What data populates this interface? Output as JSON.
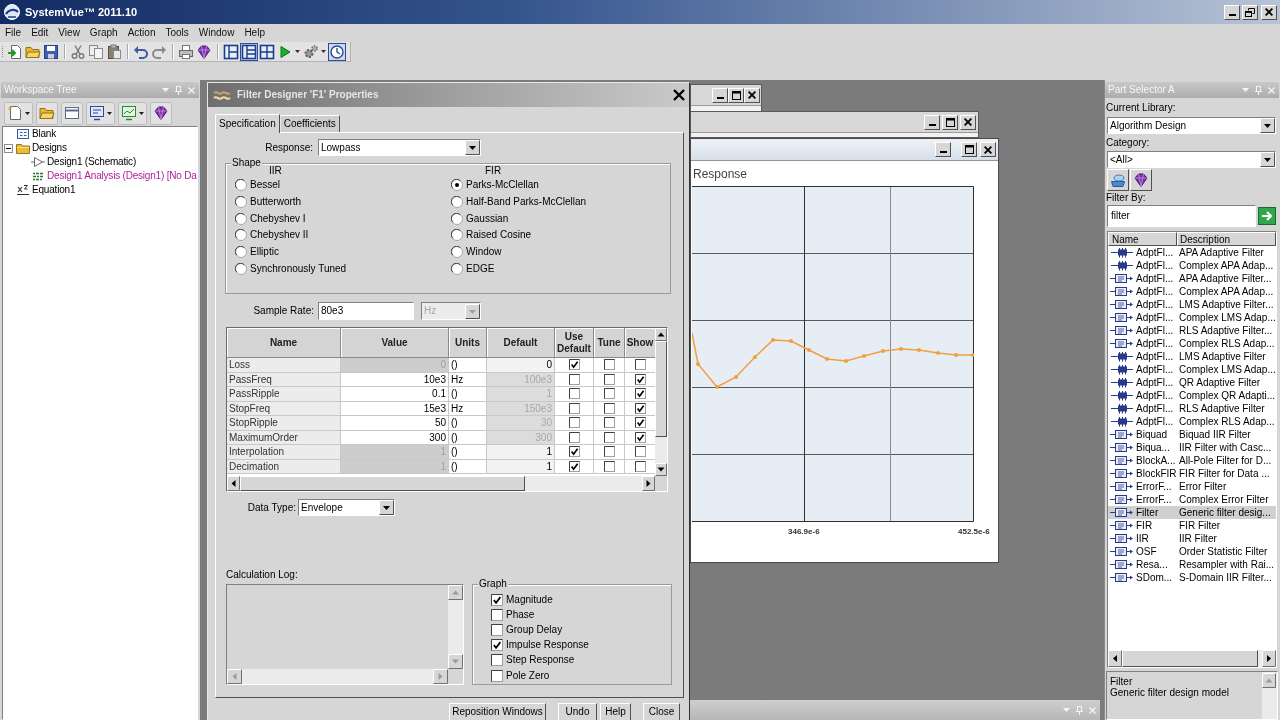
{
  "app": {
    "title": "SystemVue™ 2011.10"
  },
  "menu": [
    "File",
    "Edit",
    "View",
    "Graph",
    "Action",
    "Tools",
    "Window",
    "Help"
  ],
  "toolbar": [
    {
      "items": [
        {
          "kind": "new",
          "pressed": false,
          "dropdown": false
        },
        {
          "kind": "open",
          "pressed": false,
          "dropdown": false
        },
        {
          "kind": "save",
          "pressed": false,
          "dropdown": false
        }
      ]
    },
    {
      "items": [
        {
          "kind": "cut",
          "pressed": false,
          "dropdown": false
        },
        {
          "kind": "copy",
          "pressed": false,
          "dropdown": false
        },
        {
          "kind": "paste",
          "pressed": false,
          "dropdown": false
        }
      ]
    },
    {
      "items": [
        {
          "kind": "undo",
          "pressed": false,
          "dropdown": false
        },
        {
          "kind": "redo",
          "pressed": false,
          "dropdown": false
        }
      ]
    },
    {
      "items": [
        {
          "kind": "print",
          "pressed": false,
          "dropdown": false
        },
        {
          "kind": "gem",
          "pressed": false,
          "dropdown": false
        }
      ]
    },
    {
      "items": [
        {
          "kind": "layout_a",
          "pressed": false,
          "dropdown": false
        },
        {
          "kind": "layout_b",
          "pressed": true,
          "dropdown": false
        },
        {
          "kind": "layout_c",
          "pressed": false,
          "dropdown": false
        },
        {
          "kind": "run",
          "pressed": false,
          "dropdown": true
        },
        {
          "kind": "gear",
          "pressed": false,
          "dropdown": true
        },
        {
          "kind": "clock",
          "pressed": true,
          "dropdown": false
        }
      ]
    }
  ],
  "workspace_tree": {
    "title": "Workspace Tree",
    "items": [
      {
        "label": "Blank",
        "kind": "blank",
        "expanded": false
      },
      {
        "label": "Designs",
        "kind": "folder",
        "expanded": true,
        "children": [
          {
            "label": "Design1 (Schematic)",
            "kind": "schematic",
            "expanded": false
          },
          {
            "label": "Design1 Analysis (Design1) [No Da",
            "kind": "analysis",
            "expanded": false
          }
        ]
      },
      {
        "label": "Equation1",
        "kind": "equation",
        "expanded": false
      }
    ]
  },
  "filter_dialog": {
    "title": "Filter Designer 'F1' Properties",
    "tabs": [
      {
        "label": "Specification",
        "selected": true
      },
      {
        "label": "Coefficients",
        "selected": false
      }
    ],
    "response": {
      "label": "Response:",
      "value": "Lowpass"
    },
    "shape": {
      "title": "Shape",
      "groups": [
        {
          "heading": "IIR",
          "options": [
            {
              "label": "Bessel",
              "selected": false
            },
            {
              "label": "Butterworth",
              "selected": false
            },
            {
              "label": "Chebyshev I",
              "selected": false
            },
            {
              "label": "Chebyshev II",
              "selected": false
            },
            {
              "label": "Elliptic",
              "selected": false
            },
            {
              "label": "Synchronously Tuned",
              "selected": false
            }
          ]
        },
        {
          "heading": "FIR",
          "options": [
            {
              "label": "Parks-McClellan",
              "selected": true
            },
            {
              "label": "Half-Band Parks-McClellan",
              "selected": false
            },
            {
              "label": "Gaussian",
              "selected": false
            },
            {
              "label": "Raised Cosine",
              "selected": false
            },
            {
              "label": "Window",
              "selected": false
            },
            {
              "label": "EDGE",
              "selected": false
            }
          ]
        }
      ]
    },
    "sample_rate": {
      "label": "Sample Rate:",
      "value": "80e3",
      "unit": "Hz",
      "unit_disabled": true
    },
    "parameters": {
      "columns": [
        "Name",
        "Value",
        "Units",
        "Default",
        "Use Default",
        "Tune",
        "Show"
      ],
      "rows": [
        {
          "name": "Loss",
          "value": "0",
          "units": "()",
          "default": "0",
          "use_default": true,
          "tune": false,
          "show": false
        },
        {
          "name": "PassFreq",
          "value": "10e3",
          "units": "Hz",
          "default": "100e3",
          "use_default": false,
          "tune": false,
          "show": true
        },
        {
          "name": "PassRipple",
          "value": "0.1",
          "units": "()",
          "default": "1",
          "use_default": false,
          "tune": false,
          "show": true
        },
        {
          "name": "StopFreq",
          "value": "15e3",
          "units": "Hz",
          "default": "150e3",
          "use_default": false,
          "tune": false,
          "show": true
        },
        {
          "name": "StopRipple",
          "value": "50",
          "units": "()",
          "default": "30",
          "use_default": false,
          "tune": false,
          "show": true
        },
        {
          "name": "MaximumOrder",
          "value": "300",
          "units": "()",
          "default": "300",
          "use_default": false,
          "tune": false,
          "show": true
        },
        {
          "name": "Interpolation",
          "value": "1",
          "units": "()",
          "default": "1",
          "use_default": true,
          "tune": false,
          "show": false
        },
        {
          "name": "Decimation",
          "value": "1",
          "units": "()",
          "default": "1",
          "use_default": true,
          "tune": false,
          "show": false
        }
      ]
    },
    "data_type": {
      "label": "Data Type:",
      "value": "Envelope"
    },
    "calculation_log": {
      "label": "Calculation Log:"
    },
    "graph": {
      "title": "Graph",
      "options": [
        {
          "label": "Magnitude",
          "checked": true
        },
        {
          "label": "Phase",
          "checked": false
        },
        {
          "label": "Group Delay",
          "checked": false
        },
        {
          "label": "Impulse Response",
          "checked": true
        },
        {
          "label": "Step Response",
          "checked": false
        },
        {
          "label": "Pole Zero",
          "checked": false
        }
      ]
    },
    "buttons": [
      "Reposition Windows",
      "Undo",
      "Help",
      "Close"
    ]
  },
  "graph_window": {
    "title": "Response",
    "x_tick_labels": [
      "346.9e-6",
      "452.5e-6"
    ]
  },
  "part_selector": {
    "title": "Part Selector A",
    "current_library": {
      "label": "Current Library:",
      "value": "Algorithm Design"
    },
    "category": {
      "label": "Category:",
      "value": "<All>"
    },
    "filter_by": {
      "label": "Filter By:",
      "value": "filter"
    },
    "columns": [
      "Name",
      "Description"
    ],
    "rows": [
      {
        "name": "AdptFl...",
        "description": "APA Adaptive Filter",
        "kind": "chip",
        "selected": false
      },
      {
        "name": "AdptFl...",
        "description": "Complex APA Adap...",
        "kind": "chip",
        "selected": false
      },
      {
        "name": "AdptFl...",
        "description": "APA Adaptive Filter...",
        "kind": "box",
        "selected": false
      },
      {
        "name": "AdptFl...",
        "description": "Complex APA Adap...",
        "kind": "box",
        "selected": false
      },
      {
        "name": "AdptFl...",
        "description": "LMS Adaptive Filter...",
        "kind": "box",
        "selected": false
      },
      {
        "name": "AdptFl...",
        "description": "Complex LMS Adap...",
        "kind": "box",
        "selected": false
      },
      {
        "name": "AdptFl...",
        "description": "RLS Adaptive Filter...",
        "kind": "box",
        "selected": false
      },
      {
        "name": "AdptFl...",
        "description": "Complex RLS Adap...",
        "kind": "box",
        "selected": false
      },
      {
        "name": "AdptFl...",
        "description": "LMS Adaptive Filter",
        "kind": "chip",
        "selected": false
      },
      {
        "name": "AdptFl...",
        "description": "Complex LMS Adap...",
        "kind": "chip",
        "selected": false
      },
      {
        "name": "AdptFl...",
        "description": "QR Adaptive Filter",
        "kind": "chip",
        "selected": false
      },
      {
        "name": "AdptFl...",
        "description": "Complex QR Adapti...",
        "kind": "chip",
        "selected": false
      },
      {
        "name": "AdptFl...",
        "description": "RLS Adaptive Filter",
        "kind": "chip",
        "selected": false
      },
      {
        "name": "AdptFl...",
        "description": "Complex RLS Adap...",
        "kind": "chip",
        "selected": false
      },
      {
        "name": "Biquad",
        "description": "Biquad IIR Filter",
        "kind": "box",
        "selected": false
      },
      {
        "name": "Biqua...",
        "description": "IIR Filter with Casc...",
        "kind": "box",
        "selected": false
      },
      {
        "name": "BlockA...",
        "description": "All-Pole Filter for D...",
        "kind": "box",
        "selected": false
      },
      {
        "name": "BlockFIR",
        "description": "FIR Filter for Data ...",
        "kind": "box",
        "selected": false
      },
      {
        "name": "ErrorF...",
        "description": "Error Filter",
        "kind": "box",
        "selected": false
      },
      {
        "name": "ErrorF...",
        "description": "Complex Error Filter",
        "kind": "box",
        "selected": false
      },
      {
        "name": "Filter",
        "description": "Generic filter desig...",
        "kind": "box",
        "selected": true
      },
      {
        "name": "FIR",
        "description": "FIR Filter",
        "kind": "box",
        "selected": false
      },
      {
        "name": "IIR",
        "description": "IIR Filter",
        "kind": "box",
        "selected": false
      },
      {
        "name": "OSF",
        "description": "Order Statistic Filter",
        "kind": "box",
        "selected": false
      },
      {
        "name": "Resa...",
        "description": "Resampler with Rai...",
        "kind": "box",
        "selected": false
      },
      {
        "name": "SDom...",
        "description": "S-Domain IIR Filter...",
        "kind": "box",
        "selected": false
      }
    ],
    "info": {
      "name": "Filter",
      "description": "Generic filter design model"
    }
  }
}
